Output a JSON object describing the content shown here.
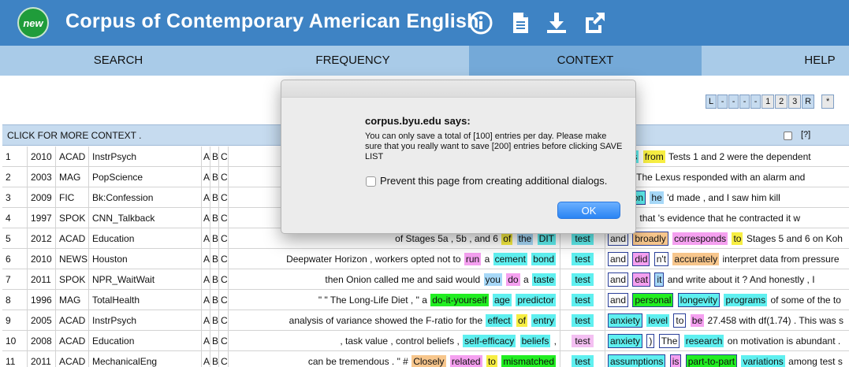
{
  "header": {
    "badge": "new",
    "title": "Corpus of Contemporary American English",
    "icons": [
      "info-icon",
      "document-icon",
      "download-icon",
      "external-link-icon"
    ],
    "bg_color": "#3e83c4"
  },
  "nav": {
    "tabs": [
      {
        "label": "SEARCH"
      },
      {
        "label": "FREQUENCY"
      },
      {
        "label": "CONTEXT",
        "active": true
      },
      {
        "label": "HELP"
      }
    ]
  },
  "pager": [
    "L",
    "-",
    "-",
    "-",
    "-",
    "1",
    "2",
    "3",
    "R",
    "*"
  ],
  "table": {
    "header_label": "CLICK FOR MORE CONTEXT .",
    "header_help": "[?]",
    "abc": [
      "A",
      "B",
      "C"
    ],
    "rows": [
      {
        "num": "1",
        "year": "2010",
        "genre": "ACAD",
        "source": "InstrPsych",
        "left": [],
        "node": "",
        "node_color": "cyan",
        "right": [
          {
            "t": "scores",
            "c": "cyan"
          },
          {
            "t": "from",
            "c": "yellow"
          },
          {
            "t": "Tests 1 and 2 were the dependent",
            "c": ""
          }
        ]
      },
      {
        "num": "2",
        "year": "2003",
        "genre": "MAG",
        "source": "PopScience",
        "left": [],
        "node": "",
        "node_color": "cyan",
        "right": [
          {
            "t": "point",
            "c": "cyan",
            "box": true
          },
          {
            "t": "The Lexus responded with an alarm and",
            "c": ""
          }
        ]
      },
      {
        "num": "3",
        "year": "2009",
        "genre": "FIC",
        "source": "Bk:Confession",
        "left": [],
        "node": "",
        "node_color": "cyan",
        "right": [
          {
            "t": "weapon",
            "c": "cyan",
            "box": true
          },
          {
            "t": "he",
            "c": "blue"
          },
          {
            "t": "'d made , and I saw him kill",
            "c": ""
          }
        ]
      },
      {
        "num": "4",
        "year": "1997",
        "genre": "SPOK",
        "source": "CNN_Talkback",
        "left": [],
        "node": "",
        "node_color": "cyan",
        "right": [
          {
            "t": "later",
            "c": "orange",
            "box": true
          },
          {
            "t": ", that 's evidence that he contracted it w",
            "c": ""
          }
        ]
      },
      {
        "num": "5",
        "year": "2012",
        "genre": "ACAD",
        "source": "Education",
        "left": [
          {
            "t": "of Stages 5a , 5b , and 6",
            "c": ""
          },
          {
            "t": "of",
            "c": "yellow"
          },
          {
            "t": "the",
            "c": "blue"
          },
          {
            "t": "DIT",
            "c": "cyan"
          }
        ],
        "node": "test",
        "node_color": "cyan",
        "right": [
          {
            "t": "and",
            "c": "",
            "box": true
          },
          {
            "t": "broadly",
            "c": "orange",
            "box": true
          },
          {
            "t": "corresponds",
            "c": "pink"
          },
          {
            "t": "to",
            "c": "yellow"
          },
          {
            "t": "Stages 5 and 6 on Koh",
            "c": ""
          }
        ]
      },
      {
        "num": "6",
        "year": "2010",
        "genre": "NEWS",
        "source": "Houston",
        "left": [
          {
            "t": "Deepwater Horizon , workers opted not to",
            "c": ""
          },
          {
            "t": "run",
            "c": "pink"
          },
          {
            "t": "a",
            "c": ""
          },
          {
            "t": "cement",
            "c": "cyan"
          },
          {
            "t": "bond",
            "c": "cyan"
          }
        ],
        "node": "test",
        "node_color": "cyan",
        "right": [
          {
            "t": "and",
            "c": "",
            "box": true
          },
          {
            "t": "did",
            "c": "pink",
            "box": true
          },
          {
            "t": "n't",
            "c": "",
            "box": true
          },
          {
            "t": "accurately",
            "c": "orange"
          },
          {
            "t": "interpret data from pressure",
            "c": ""
          }
        ]
      },
      {
        "num": "7",
        "year": "2011",
        "genre": "SPOK",
        "source": "NPR_WaitWait",
        "left": [
          {
            "t": "then Onion called me and said would",
            "c": ""
          },
          {
            "t": "you",
            "c": "blue"
          },
          {
            "t": "do",
            "c": "pink"
          },
          {
            "t": "a",
            "c": ""
          },
          {
            "t": "taste",
            "c": "cyan"
          }
        ],
        "node": "test",
        "node_color": "cyan",
        "right": [
          {
            "t": "and",
            "c": "",
            "box": true
          },
          {
            "t": "eat",
            "c": "pink",
            "box": true
          },
          {
            "t": "it",
            "c": "blue",
            "box": true
          },
          {
            "t": "and write about it ? And honestly , I",
            "c": ""
          }
        ]
      },
      {
        "num": "8",
        "year": "1996",
        "genre": "MAG",
        "source": "TotalHealth",
        "left": [
          {
            "t": "\" \" The Long-Life Diet , \"",
            "c": ""
          },
          {
            "t": "a",
            "c": ""
          },
          {
            "t": "do-it-yourself",
            "c": "green"
          },
          {
            "t": "age",
            "c": "cyan"
          },
          {
            "t": "predictor",
            "c": "cyan"
          }
        ],
        "node": "test",
        "node_color": "cyan",
        "right": [
          {
            "t": "and",
            "c": "",
            "box": true
          },
          {
            "t": "personal",
            "c": "green",
            "box": true
          },
          {
            "t": "longevity",
            "c": "cyan",
            "box": true
          },
          {
            "t": "programs",
            "c": "cyan"
          },
          {
            "t": "of some of the to",
            "c": ""
          }
        ]
      },
      {
        "num": "9",
        "year": "2005",
        "genre": "ACAD",
        "source": "InstrPsych",
        "left": [
          {
            "t": "analysis of variance showed the F-ratio for",
            "c": ""
          },
          {
            "t": "the",
            "c": ""
          },
          {
            "t": "effect",
            "c": "cyan"
          },
          {
            "t": "of",
            "c": "yellow"
          },
          {
            "t": "entry",
            "c": "cyan"
          }
        ],
        "node": "test",
        "node_color": "cyan",
        "right": [
          {
            "t": "anxiety",
            "c": "cyan",
            "box": true
          },
          {
            "t": "level",
            "c": "cyan"
          },
          {
            "t": "to",
            "c": "",
            "box": true
          },
          {
            "t": "be",
            "c": "pink"
          },
          {
            "t": "27.458 with df(1.74) . This was s",
            "c": ""
          }
        ]
      },
      {
        "num": "10",
        "year": "2008",
        "genre": "ACAD",
        "source": "Education",
        "left": [
          {
            "t": ", task value , control beliefs",
            "c": ""
          },
          {
            "t": ",",
            "c": ""
          },
          {
            "t": "self-efficacy",
            "c": "cyan"
          },
          {
            "t": "beliefs",
            "c": "cyan"
          },
          {
            "t": ",",
            "c": ""
          }
        ],
        "node": "test",
        "node_color": "pink",
        "right": [
          {
            "t": "anxiety",
            "c": "cyan",
            "box": true
          },
          {
            "t": ")",
            "c": "",
            "box": true
          },
          {
            "t": "The",
            "c": "",
            "box": true
          },
          {
            "t": "research",
            "c": "cyan"
          },
          {
            "t": "on motivation is abundant .",
            "c": ""
          }
        ]
      },
      {
        "num": "11",
        "year": "2011",
        "genre": "ACAD",
        "source": "MechanicalEng",
        "left": [
          {
            "t": "can be tremendous . \" #",
            "c": ""
          },
          {
            "t": "Closely",
            "c": "orange"
          },
          {
            "t": "related",
            "c": "pink"
          },
          {
            "t": "to",
            "c": "yellow"
          },
          {
            "t": "mismatched",
            "c": "green"
          }
        ],
        "node": "test",
        "node_color": "cyan",
        "right": [
          {
            "t": "assumptions",
            "c": "cyan",
            "box": true
          },
          {
            "t": "is",
            "c": "pink",
            "box": true
          },
          {
            "t": "part-to-part",
            "c": "green",
            "box": true
          },
          {
            "t": "variations",
            "c": "cyan"
          },
          {
            "t": "among test s",
            "c": ""
          }
        ]
      }
    ],
    "partial_row4_left": "s"
  },
  "dialog": {
    "title": "corpus.byu.edu says:",
    "message": "You can only save a total of [100] entries per day. Please make sure that you really want to save [200] entries before clicking SAVE LIST",
    "checkbox_label": "Prevent this page from creating additional dialogs.",
    "ok_label": "OK"
  }
}
